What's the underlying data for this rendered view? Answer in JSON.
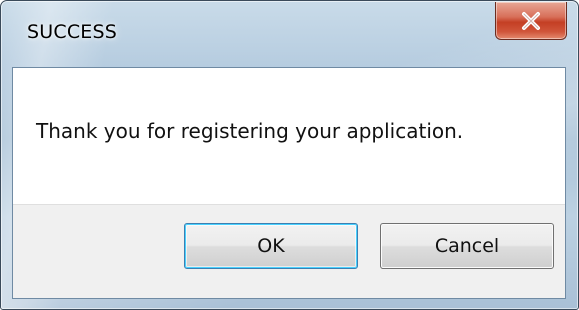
{
  "window": {
    "title": "SUCCESS",
    "close_icon": "close-x-icon"
  },
  "message": {
    "text": "Thank you for registering your application."
  },
  "buttons": {
    "ok_label": "OK",
    "cancel_label": "Cancel"
  },
  "colors": {
    "close_button": "#c9482c",
    "default_button_border": "#3c7fb1",
    "button_bar_background": "#f0f0f0"
  }
}
